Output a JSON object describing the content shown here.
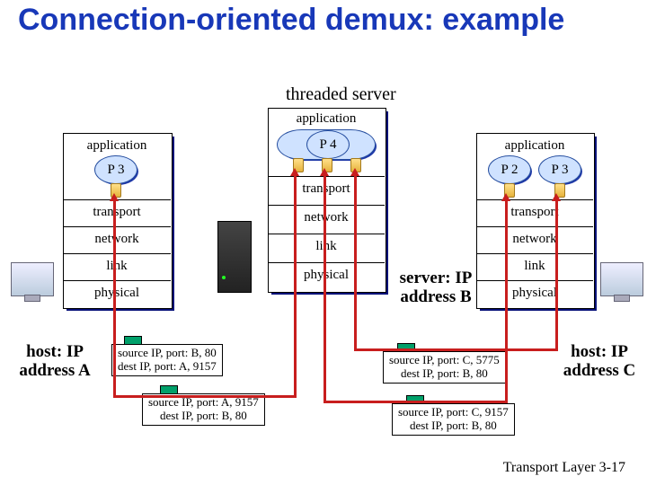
{
  "title": "Connection-oriented demux: example",
  "threaded_label": "threaded server",
  "layers": {
    "application": "application",
    "transport": "transport",
    "network": "network",
    "link": "link",
    "physical": "physical"
  },
  "procs": {
    "p2": "P 2",
    "p3": "P 3",
    "p4": "P 4"
  },
  "hosts": {
    "a": "host: IP address A",
    "b": "server: IP address B",
    "c": "host: IP address C"
  },
  "packets": {
    "ba": {
      "l1": "source IP, port: B, 80",
      "l2": "dest IP, port: A, 9157"
    },
    "ab": {
      "l1": "source IP, port: A, 9157",
      "l2": "dest IP, port: B, 80"
    },
    "cb1": {
      "l1": "source IP, port: C, 5775",
      "l2": "dest IP, port: B, 80"
    },
    "cb2": {
      "l1": "source IP, port: C, 9157",
      "l2": "dest IP, port: B, 80"
    }
  },
  "footer": {
    "text": "Transport Layer",
    "page": "3-17"
  }
}
